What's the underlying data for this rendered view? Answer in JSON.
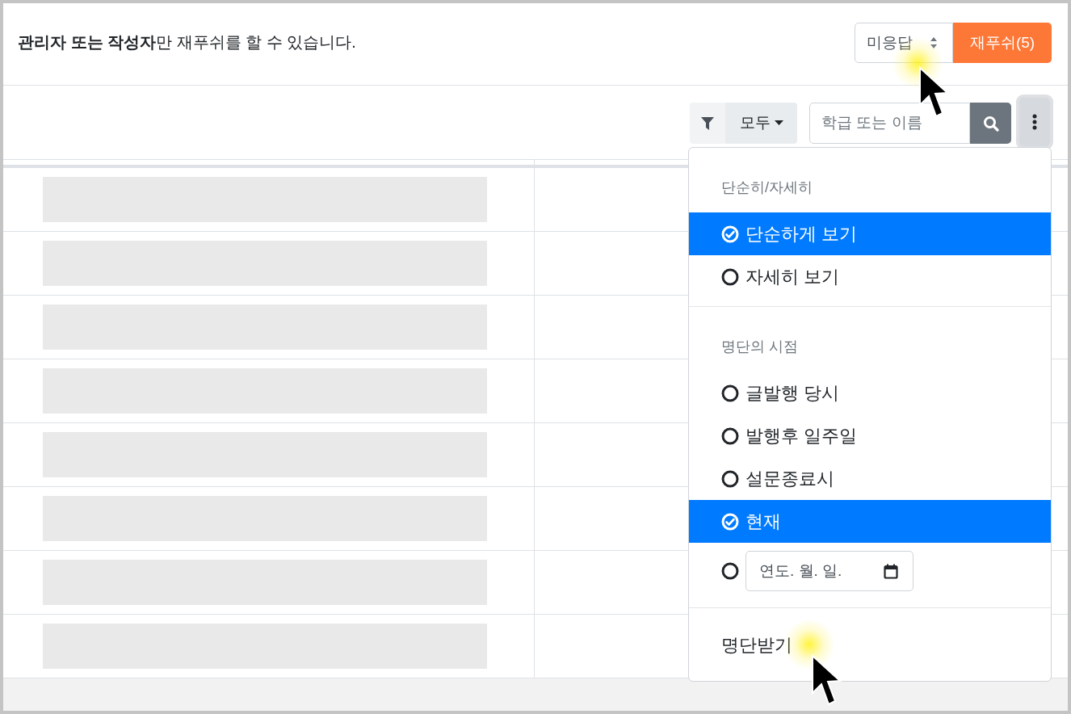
{
  "notice": "**관리자 또는 작성자**만 재푸쉬를 할 수 있습니다.",
  "sort_select": {
    "value": "미응답"
  },
  "repush_button": {
    "label": "재푸쉬(5)"
  },
  "filter": {
    "value": "모두"
  },
  "search": {
    "placeholder": "학급 또는 이름"
  },
  "menu": {
    "sections": [
      {
        "header": "단순히/자세히",
        "items": [
          {
            "kind": "option",
            "label": "단순하게 보기",
            "selected": true
          },
          {
            "kind": "option",
            "label": "자세히 보기",
            "selected": false
          }
        ]
      },
      {
        "header": "명단의 시점",
        "items": [
          {
            "kind": "option",
            "label": "글발행 당시",
            "selected": false
          },
          {
            "kind": "option",
            "label": "발행후 일주일",
            "selected": false
          },
          {
            "kind": "option",
            "label": "설문종료시",
            "selected": false
          },
          {
            "kind": "option",
            "label": "현재",
            "selected": true
          },
          {
            "kind": "date",
            "placeholder": "연도. 월. 일.",
            "selected": false
          }
        ]
      },
      {
        "items": [
          {
            "kind": "action",
            "label": "명단받기"
          }
        ]
      }
    ]
  },
  "table": {
    "rows": [
      {
        "kind": "loading"
      },
      {
        "kind": "loading"
      },
      {
        "kind": "loading"
      },
      {
        "kind": "loading"
      },
      {
        "kind": "loading"
      },
      {
        "kind": "loading"
      },
      {
        "kind": "loading"
      },
      {
        "kind": "loading"
      }
    ]
  }
}
